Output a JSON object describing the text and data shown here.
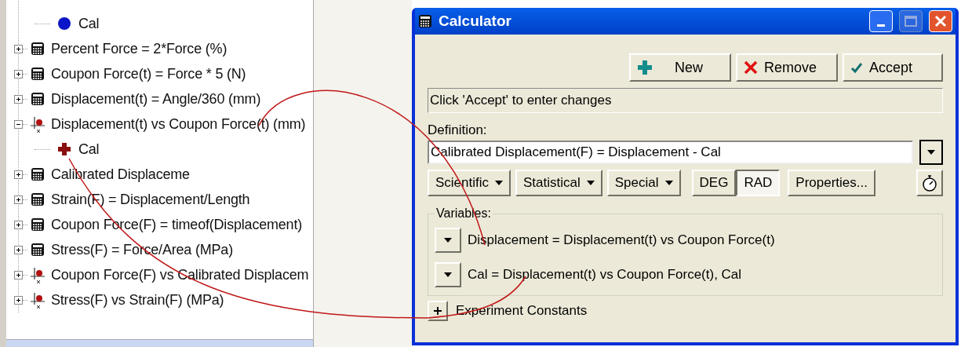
{
  "tree": {
    "partial_children": [
      {
        "kind": "dot",
        "label": "Cal"
      }
    ],
    "items": [
      {
        "kind": "calc",
        "label": "Percent Force = 2*Force (%)",
        "expanded": false
      },
      {
        "kind": "calc",
        "label": "Coupon Force(t) = Force * 5 (N)",
        "expanded": false
      },
      {
        "kind": "calc",
        "label": "Displacement(t) = Angle/360 (mm)",
        "expanded": false
      },
      {
        "kind": "plot",
        "label": "Displacement(t) vs Coupon Force(t) (mm)",
        "expanded": true,
        "children": [
          {
            "kind": "cross",
            "label": "Cal"
          }
        ]
      },
      {
        "kind": "calc",
        "label": "Calibrated Displaceme",
        "expanded": false
      },
      {
        "kind": "calc",
        "label": "Strain(F) = Displacement/Length",
        "expanded": false
      },
      {
        "kind": "calc",
        "label": "Coupon Force(F) = timeof(Displacement)",
        "expanded": false
      },
      {
        "kind": "calc",
        "label": "Stress(F) = Force/Area (MPa)",
        "expanded": false
      },
      {
        "kind": "plot",
        "label": "Coupon Force(F) vs Calibrated Displacem",
        "expanded": false
      },
      {
        "kind": "plot",
        "label": "Stress(F) vs Strain(F) (MPa)",
        "expanded": false
      }
    ]
  },
  "window": {
    "title": "Calculator"
  },
  "toolbar": [
    {
      "kind": "new",
      "label": "New"
    },
    {
      "kind": "remove",
      "label": "Remove"
    },
    {
      "kind": "accept",
      "label": "Accept"
    }
  ],
  "status": "Click 'Accept' to enter changes",
  "definition": {
    "label": "Definition:",
    "value": "Calibrated Displacement(F) = Displacement - Cal"
  },
  "function_menus": [
    "Scientific",
    "Statistical",
    "Special"
  ],
  "angle_modes": [
    {
      "label": "DEG",
      "selected": false
    },
    {
      "label": "RAD",
      "selected": true
    }
  ],
  "properties_button": "Properties...",
  "variables": {
    "title": "Variables:",
    "items": [
      "Displacement = Displacement(t) vs Coupon Force(t)",
      "Cal = Displacement(t) vs Coupon Force(t), Cal"
    ]
  },
  "experiment_constants": {
    "label": "Experiment Constants",
    "expanded": false
  }
}
